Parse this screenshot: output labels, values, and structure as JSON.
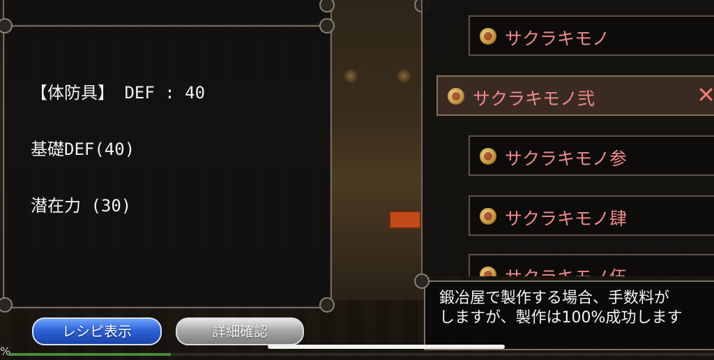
{
  "info_panel": {
    "lines": [
      "【体防具】 DEF : 40",
      "基礎DEF(40)",
      "潜在力 (30)"
    ]
  },
  "buttons": {
    "recipe_label": "レシピ表示",
    "detail_label": "詳細確認"
  },
  "recipe_list": {
    "items": [
      {
        "label": "サクラキモノ",
        "selected": false,
        "icon": "material-icon"
      },
      {
        "label": "サクラキモノ弐",
        "selected": true,
        "icon": "material-icon"
      },
      {
        "label": "サクラキモノ参",
        "selected": false,
        "icon": "material-icon"
      },
      {
        "label": "サクラキモノ肆",
        "selected": false,
        "icon": "material-icon"
      },
      {
        "label": "サクラキモノ伍",
        "selected": false,
        "icon": "material-icon"
      }
    ],
    "close_glyph": "✕"
  },
  "message": {
    "lines": [
      "鍛冶屋で製作する場合、手数料が",
      "しますが、製作は100%成功します"
    ]
  },
  "footer": {
    "percent_symbol": "%",
    "progress": 0.23
  },
  "colors": {
    "item_text": "#f08a8a",
    "recipe_button": "#2e64d8",
    "detail_button": "#a9a9a9"
  }
}
